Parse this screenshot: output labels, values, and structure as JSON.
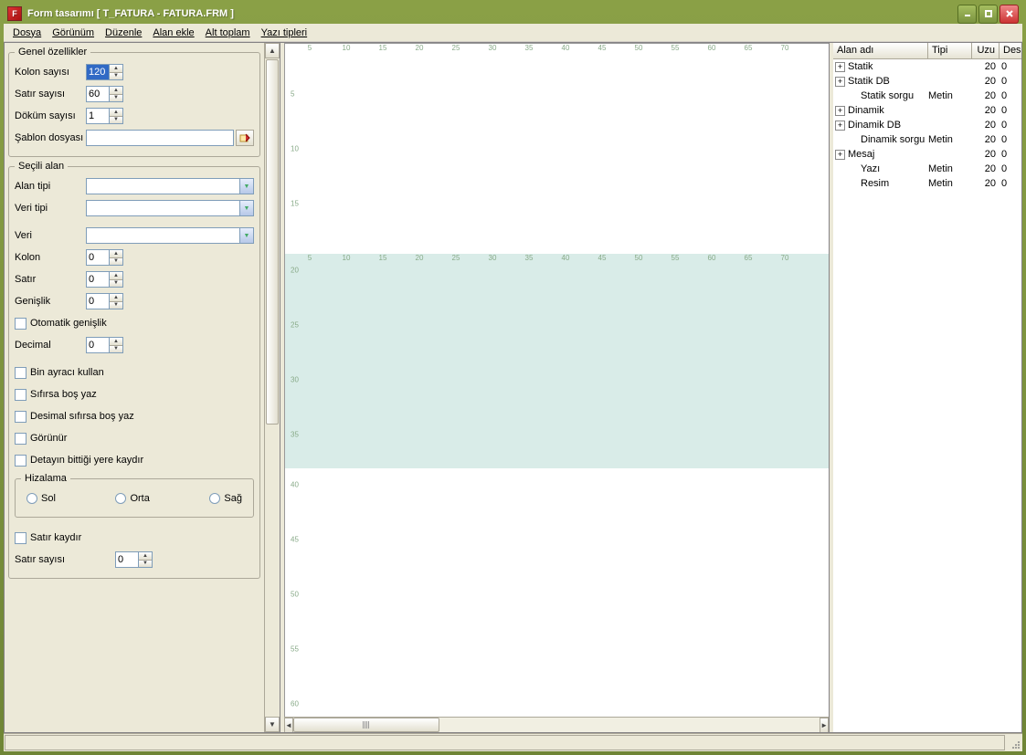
{
  "window": {
    "title": "Form tasarımı [ T_FATURA - FATURA.FRM ]"
  },
  "menu": {
    "dosya": "Dosya",
    "gorunum": "Görünüm",
    "duzenle": "Düzenle",
    "alan_ekle": "Alan ekle",
    "alt_toplam": "Alt toplam",
    "yazi_tipleri": "Yazı tipleri"
  },
  "general": {
    "legend": "Genel özellikler",
    "kolon_label": "Kolon sayısı",
    "kolon_value": "120",
    "satir_label": "Satır sayısı",
    "satir_value": "60",
    "dokum_label": "Döküm sayısı",
    "dokum_value": "1",
    "sablon_label": "Şablon dosyası",
    "sablon_value": ""
  },
  "selected": {
    "legend": "Seçili alan",
    "alan_tipi_label": "Alan tipi",
    "veri_tipi_label": "Veri tipi",
    "veri_label": "Veri",
    "kolon_label": "Kolon",
    "kolon_value": "0",
    "satir_label": "Satır",
    "satir_value": "0",
    "genislik_label": "Genişlik",
    "genislik_value": "0",
    "oto_genislik": "Otomatik genişlik",
    "decimal_label": "Decimal",
    "decimal_value": "0",
    "bin_ayrac": "Bin ayracı kullan",
    "sifirsa_bos": "Sıfırsa boş yaz",
    "desimal_sifirsa": "Desimal sıfırsa boş yaz",
    "gorunur": "Görünür",
    "detay_kaydir": "Detayın bittiği yere kaydır"
  },
  "align": {
    "legend": "Hizalama",
    "sol": "Sol",
    "orta": "Orta",
    "sag": "Sağ"
  },
  "wrap": {
    "satir_kaydir": "Satır kaydır",
    "satir_sayisi_label": "Satır sayısı",
    "satir_sayisi_value": "0"
  },
  "ruler_h": [
    "5",
    "10",
    "15",
    "20",
    "25",
    "30",
    "35",
    "40",
    "45",
    "50",
    "55",
    "60",
    "65",
    "70"
  ],
  "ruler_v_top": [
    "5",
    "10",
    "15"
  ],
  "ruler_mid_h": [
    "5",
    "10",
    "15",
    "20",
    "25",
    "30",
    "35",
    "40",
    "45",
    "50",
    "55",
    "60",
    "65",
    "70"
  ],
  "ruler_v_mid": [
    "20",
    "25",
    "30",
    "35"
  ],
  "ruler_v_bot": [
    "40",
    "45",
    "50",
    "55",
    "60"
  ],
  "tree": {
    "headers": {
      "name": "Alan adı",
      "type": "Tipi",
      "len": "Uzu",
      "dec": "Des"
    },
    "rows": [
      {
        "expand": "+",
        "name": "Statik",
        "type": "",
        "len": "20",
        "dec": "0"
      },
      {
        "expand": "+",
        "name": "Statik DB",
        "type": "",
        "len": "20",
        "dec": "0"
      },
      {
        "expand": "",
        "name": "Statik sorgu",
        "type": "Metin",
        "len": "20",
        "dec": "0",
        "indent": true
      },
      {
        "expand": "+",
        "name": "Dinamik",
        "type": "",
        "len": "20",
        "dec": "0"
      },
      {
        "expand": "+",
        "name": "Dinamik DB",
        "type": "",
        "len": "20",
        "dec": "0"
      },
      {
        "expand": "",
        "name": "Dinamik sorgu",
        "type": "Metin",
        "len": "20",
        "dec": "0",
        "indent": true
      },
      {
        "expand": "+",
        "name": "Mesaj",
        "type": "",
        "len": "20",
        "dec": "0"
      },
      {
        "expand": "",
        "name": "Yazı",
        "type": "Metin",
        "len": "20",
        "dec": "0",
        "indent": true
      },
      {
        "expand": "",
        "name": "Resim",
        "type": "Metin",
        "len": "20",
        "dec": "0",
        "indent": true
      }
    ]
  }
}
